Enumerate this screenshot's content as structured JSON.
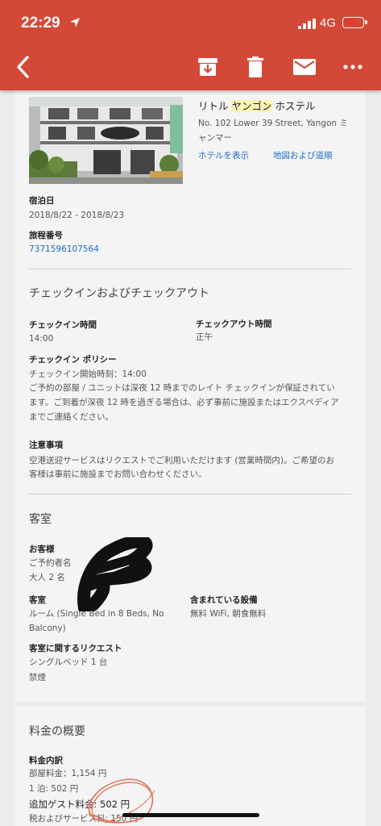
{
  "status_bar": {
    "time": "22:29",
    "network": "4G"
  },
  "toolbar": {
    "icons": [
      "back-arrow-icon",
      "archive-icon",
      "trash-icon",
      "mail-icon",
      "more-horizontal-icon"
    ],
    "accent_color": "#d34836"
  },
  "hotel": {
    "name_prefix": "リトル ",
    "name_highlight": "ヤンゴン",
    "name_suffix": " ホステル",
    "address": "No. 102 Lower 39 Street, Yangon ミャンマー",
    "view_hotel_link": "ホテルを表示",
    "map_link": "地図および道順"
  },
  "stay": {
    "dates_label": "宿泊日",
    "dates_value": "2018/8/22 - 2018/8/23",
    "itinerary_label": "旅程番号",
    "itinerary_value": "7371596107564"
  },
  "checkin_section": {
    "title": "チェックインおよびチェックアウト",
    "checkin_time_label": "チェックイン時間",
    "checkin_time_value": "14:00",
    "checkout_time_label": "チェックアウト時間",
    "checkout_time_value": "正午",
    "policy_label": "チェックイン ポリシー",
    "policy_line1": "チェックイン開始時刻：14:00",
    "policy_line2": "ご予約の部屋 / ユニットは深夜 12 時までのレイト チェックインが保証されてい",
    "policy_line3": "ます。ご到着が深夜 12 時を過ぎる場合は、必ず事前に施設またはエクスペディア",
    "policy_line4": "までご連絡ください。",
    "notes_label": "注意事項",
    "notes_line1": "空港送迎サービスはリクエストでご利用いただけます (営業時間内)。ご希望のお",
    "notes_line2": "客様は事前に施設までお問い合わせください。"
  },
  "room_section": {
    "title": "客室",
    "guest_label": "お客様",
    "guest_name_label": "ご予約者名",
    "guest_count": "大人 2 名",
    "room_label": "客室",
    "room_line1": "ルーム (Single Bed in 8 Beds, No",
    "room_line2": "Balcony)",
    "amenities_label": "含まれている設備",
    "amenities_value": "無料 WiFi, 朝食無料",
    "request_label": "客室に関するリクエスト",
    "request_line1": "シングルベッド 1 台",
    "request_line2": "禁煙"
  },
  "price_section": {
    "title": "料金の概要",
    "breakdown_label": "料金内訳",
    "room_charge": "部屋料金：1,154 円",
    "per_night": "1 泊: 502 円",
    "extra_guest": "追加ゲスト料金: 502 円",
    "taxes": "税およびサービス料: 150 円"
  }
}
